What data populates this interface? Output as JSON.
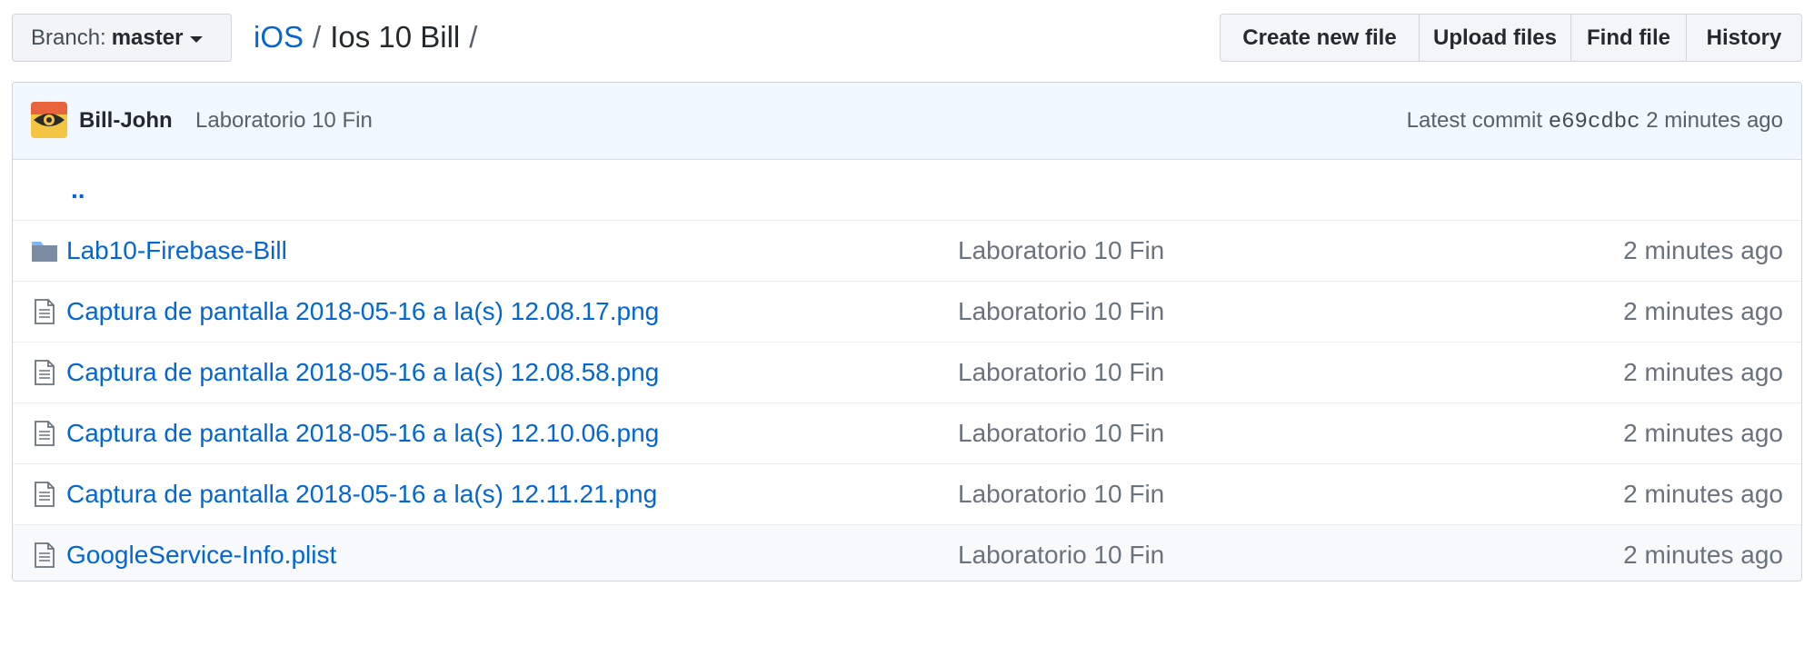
{
  "branch": {
    "label": "Branch:",
    "value": "master"
  },
  "breadcrumb": {
    "repo": "iOS",
    "separator": "/",
    "current": "Ios 10 Bill"
  },
  "actions": {
    "create": "Create new file",
    "upload": "Upload files",
    "find": "Find file",
    "history": "History"
  },
  "commit": {
    "author": "Bill-John",
    "message": "Laboratorio 10 Fin",
    "prefix": "Latest commit",
    "sha": "e69cdbc",
    "age": "2 minutes ago"
  },
  "up_dir": "..",
  "files": [
    {
      "type": "folder",
      "icon": "folder-icon",
      "name": "Lab10-Firebase-Bill",
      "message": "Laboratorio 10 Fin",
      "age": "2 minutes ago"
    },
    {
      "type": "file",
      "icon": "file-icon",
      "name": "Captura de pantalla 2018-05-16 a la(s) 12.08.17.png",
      "message": "Laboratorio 10 Fin",
      "age": "2 minutes ago"
    },
    {
      "type": "file",
      "icon": "file-icon",
      "name": "Captura de pantalla 2018-05-16 a la(s) 12.08.58.png",
      "message": "Laboratorio 10 Fin",
      "age": "2 minutes ago"
    },
    {
      "type": "file",
      "icon": "file-icon",
      "name": "Captura de pantalla 2018-05-16 a la(s) 12.10.06.png",
      "message": "Laboratorio 10 Fin",
      "age": "2 minutes ago"
    },
    {
      "type": "file",
      "icon": "file-icon",
      "name": "Captura de pantalla 2018-05-16 a la(s) 12.11.21.png",
      "message": "Laboratorio 10 Fin",
      "age": "2 minutes ago"
    },
    {
      "type": "file",
      "icon": "file-icon",
      "name": "GoogleService-Info.plist",
      "message": "Laboratorio 10 Fin",
      "age": "2 minutes ago"
    }
  ],
  "colors": {
    "link": "#0366d6",
    "commit_bg": "#f1f8ff",
    "muted": "#6a737d"
  }
}
